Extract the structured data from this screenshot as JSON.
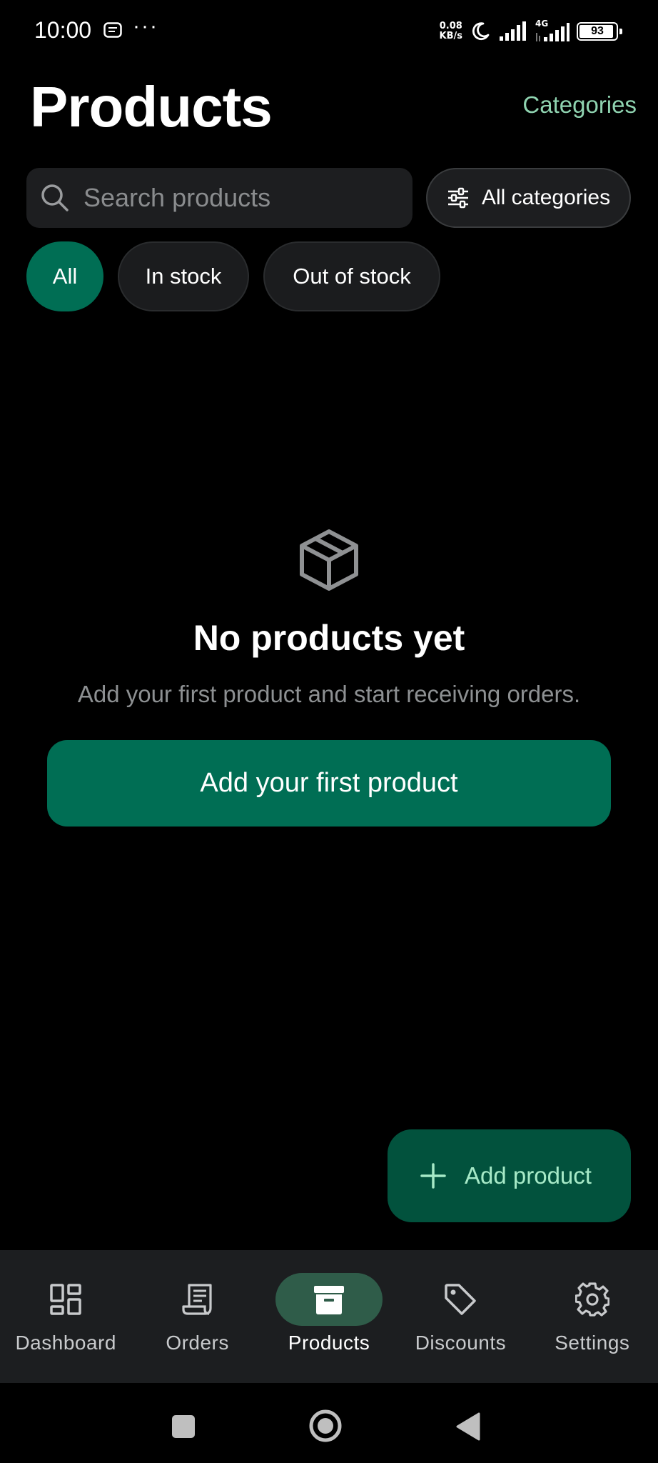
{
  "status_bar": {
    "time": "10:00",
    "dots": "···",
    "net_speed_value": "0.08",
    "net_speed_unit": "KB/s",
    "network_type": "4G",
    "battery_level": "93",
    "battery_fraction": 0.93,
    "icons": [
      "message-icon",
      "moon-icon",
      "signal-icon",
      "signal-4g-icon",
      "battery-icon"
    ]
  },
  "header": {
    "title": "Products",
    "categories_link": "Categories"
  },
  "search": {
    "placeholder": "Search products",
    "value": ""
  },
  "category_filter": {
    "label": "All categories",
    "icon": "filter-sliders-icon"
  },
  "chips": [
    {
      "label": "All",
      "selected": true
    },
    {
      "label": "In stock",
      "selected": false
    },
    {
      "label": "Out of stock",
      "selected": false
    }
  ],
  "empty_state": {
    "icon": "package-box-icon",
    "title": "No products yet",
    "subtitle": "Add your first product and start receiving orders.",
    "button": "Add your first product"
  },
  "fab": {
    "label": "Add product",
    "icon": "plus-icon"
  },
  "bottom_nav": {
    "items": [
      {
        "label": "Dashboard",
        "icon": "dashboard-icon",
        "active": false
      },
      {
        "label": "Orders",
        "icon": "receipt-icon",
        "active": false
      },
      {
        "label": "Products",
        "icon": "archive-box-icon",
        "active": true
      },
      {
        "label": "Discounts",
        "icon": "tag-icon",
        "active": false
      },
      {
        "label": "Settings",
        "icon": "gear-icon",
        "active": false
      }
    ]
  },
  "colors": {
    "accent": "#006e54",
    "accent_dark": "#02523d",
    "accent_text": "#8fd3b0",
    "surface": "#1d1e20",
    "background": "#000000"
  }
}
